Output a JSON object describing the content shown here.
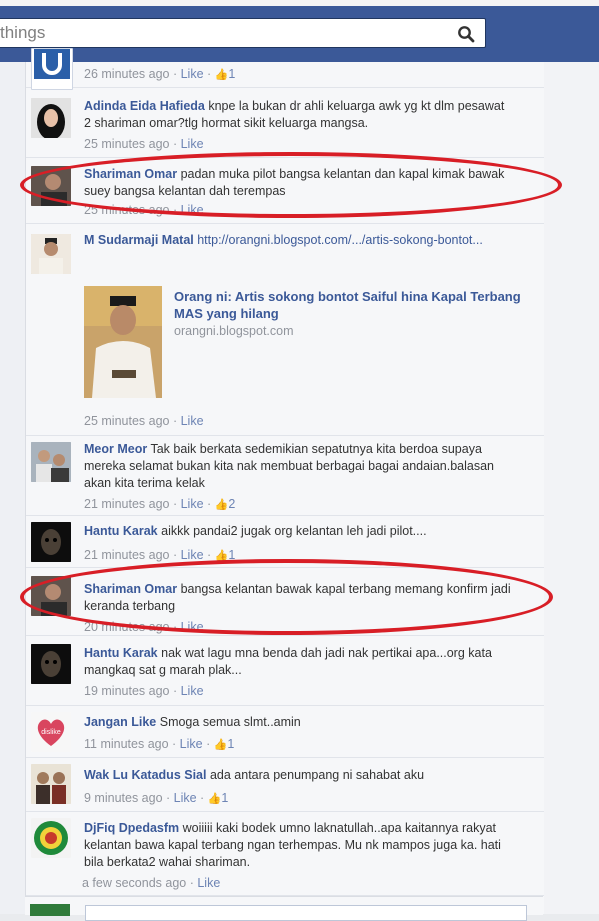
{
  "search": {
    "value": "",
    "placeholder": "things"
  },
  "comments": [
    {
      "id": "c0",
      "name": "",
      "text": "",
      "time": "26 minutes ago",
      "like": "Like",
      "count": "1"
    },
    {
      "id": "c1",
      "name": "Adinda Eida Hafieda",
      "text": "knpe la bukan dr ahli keluarga awk yg kt dlm pesawat 2 shariman omar?tlg hormat sikit keluarga mangsa.",
      "time": "25 minutes ago",
      "like": "Like",
      "count": ""
    },
    {
      "id": "c2",
      "name": "Shariman Omar",
      "text": "padan muka pilot bangsa kelantan dan kapal kimak bawak suey bangsa kelantan dah terempas",
      "time": "25 minutes ago",
      "like": "Like",
      "count": ""
    },
    {
      "id": "c3",
      "name": "M Sudarmaji Matal",
      "link": "http://orangni.blogspot.com/.../artis-sokong-bontot...",
      "text": "",
      "preview_title": "Orang ni: Artis sokong bontot Saiful hina Kapal Terbang MAS yang hilang",
      "preview_host": "orangni.blogspot.com",
      "time": "25 minutes ago",
      "like": "Like",
      "count": ""
    },
    {
      "id": "c4",
      "name": "Meor Meor",
      "text": "Tak baik berkata sedemikian sepatutnya kita berdoa supaya mereka selamat bukan kita nak membuat berbagai bagai andaian.balasan akan kita terima kelak",
      "time": "21 minutes ago",
      "like": "Like",
      "count": "2"
    },
    {
      "id": "c5",
      "name": "Hantu Karak",
      "text": "aikkk pandai2 jugak org kelantan leh jadi pilot....",
      "time": "21 minutes ago",
      "like": "Like",
      "count": "1"
    },
    {
      "id": "c6",
      "name": "Shariman Omar",
      "text": "bangsa kelantan bawak kapal terbang memang konfirm jadi keranda terbang",
      "time": "20 minutes ago",
      "like": "Like",
      "count": ""
    },
    {
      "id": "c7",
      "name": "Hantu Karak",
      "text": "nak wat lagu mna benda dah jadi nak pertikai apa...org kata mangkaq sat g marah plak...",
      "time": "19 minutes ago",
      "like": "Like",
      "count": ""
    },
    {
      "id": "c8",
      "name": "Jangan Like",
      "text": "Smoga semua slmt..amin",
      "time": "11 minutes ago",
      "like": "Like",
      "count": "1"
    },
    {
      "id": "c9",
      "name": "Wak Lu Katadus Sial",
      "text": "ada antara penumpang ni sahabat aku",
      "time": "9 minutes ago",
      "like": "Like",
      "count": "1"
    },
    {
      "id": "c10",
      "name": "DjFiq Dpedasfm",
      "text": "woiiiii kaki bodek umno laknatullah..apa kaitannya rakyat kelantan bawa kapal terbang ngan terhempas. Mu nk mampos juga ka. hati bila berkata2 wahai shariman.",
      "time": "a few seconds ago",
      "like": "Like",
      "count": ""
    }
  ],
  "separator": " · ",
  "colors": {
    "facebook_blue": "#3b5998",
    "highlight_red": "#d81e26",
    "meta_gray": "#90949c"
  },
  "icons": {
    "search": "search-icon",
    "like": "thumbs-up-icon"
  }
}
